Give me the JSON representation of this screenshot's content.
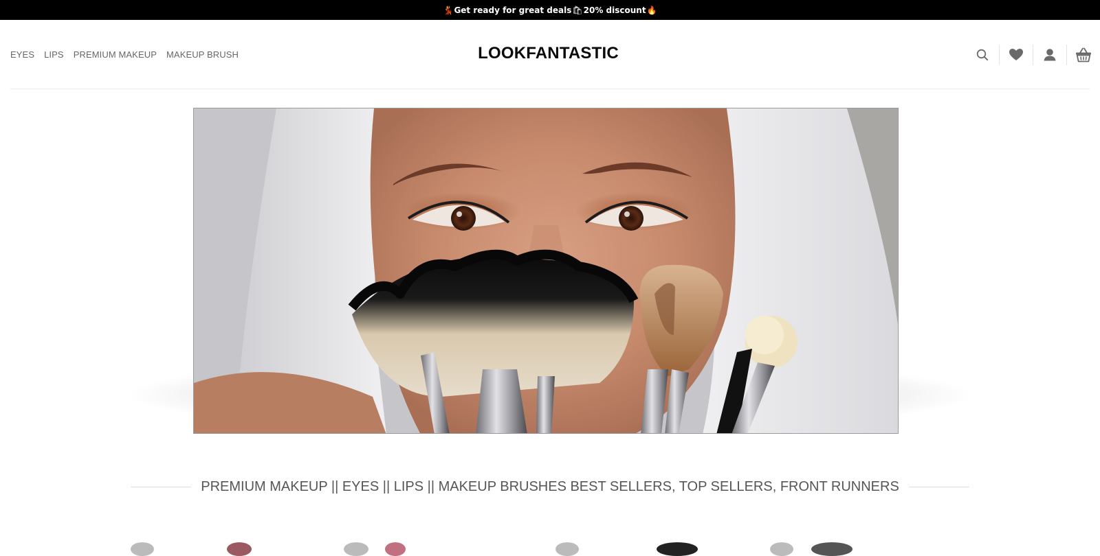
{
  "announcement": {
    "emoji_start": "💃",
    "text1": "Get ready for great deals ",
    "emoji_mid": "🛍",
    "text2": "20% discount",
    "emoji_end": "🔥"
  },
  "header": {
    "nav": [
      "EYES",
      "LIPS",
      "PREMIUM MAKEUP",
      "MAKEUP BRUSH"
    ],
    "logo": "LOOKFANTASTIC",
    "icons": [
      "search-icon",
      "heart-icon",
      "user-icon",
      "basket-icon"
    ]
  },
  "hero": {
    "image": "woman-with-makeup-brushes"
  },
  "section": {
    "title": "PREMIUM MAKEUP || EYES || LIPS || MAKEUP BRUSHES BEST SELLERS, TOP SELLERS, FRONT RUNNERS"
  },
  "colors": {
    "topbar_bg": "#000000",
    "nav_text": "#666666",
    "logo_text": "#0a0a0a",
    "section_text": "#555555"
  }
}
